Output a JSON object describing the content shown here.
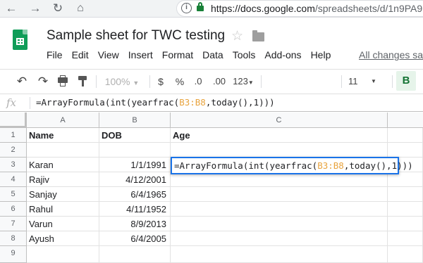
{
  "browser": {
    "url_host": "https://docs.google.com",
    "url_path": "/spreadsheets/d/1n9PA9",
    "back_icon": "arrow-left",
    "forward_icon": "arrow-right",
    "reload_icon": "reload",
    "home_icon": "home",
    "info_icon": "info",
    "lock_icon": "lock"
  },
  "doc": {
    "title": "Sample sheet for TWC testing",
    "star_icon": "☆",
    "saved_status": "All changes sa"
  },
  "menu": [
    "File",
    "Edit",
    "View",
    "Insert",
    "Format",
    "Data",
    "Tools",
    "Add-ons",
    "Help"
  ],
  "toolbar": {
    "zoom": "100%",
    "currency": "$",
    "percent": "%",
    "decimal_decrease": ".0",
    "decimal_increase": ".00",
    "format_more": "123",
    "font_size": "11",
    "bold": "B"
  },
  "formula_bar": {
    "fx": "fx",
    "formula_prefix": "=ArrayFormula(int(yearfrac(",
    "formula_ref": "B3:B8",
    "formula_suffix": ",today(),1)))"
  },
  "grid": {
    "columns": [
      "A",
      "B",
      "C"
    ],
    "rows": [
      "1",
      "2",
      "3",
      "4",
      "5",
      "6",
      "7",
      "8",
      "9"
    ],
    "header": {
      "a": "Name",
      "b": "DOB",
      "c": "Age"
    },
    "data": [
      {
        "name": "Karan",
        "dob": "1/1/1991"
      },
      {
        "name": "Rajiv",
        "dob": "4/12/2001"
      },
      {
        "name": "Sanjay",
        "dob": "6/4/1965"
      },
      {
        "name": "Rahul",
        "dob": "4/11/1952"
      },
      {
        "name": "Varun",
        "dob": "8/9/2013"
      },
      {
        "name": "Ayush",
        "dob": "6/4/2005"
      }
    ]
  },
  "colors": {
    "accent_blue": "#1a73e8",
    "sheets_green": "#0f9d58",
    "ref_orange": "#e8a33d"
  }
}
